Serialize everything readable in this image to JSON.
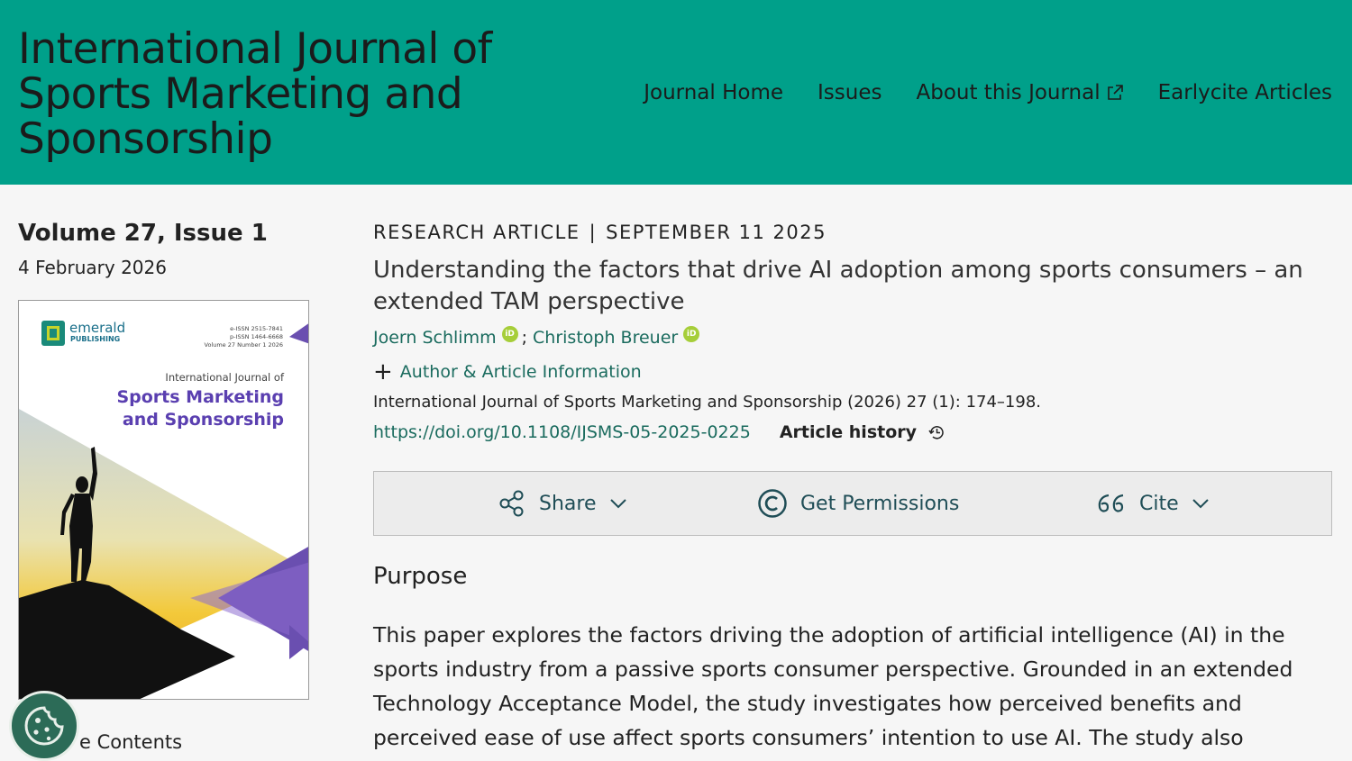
{
  "header": {
    "journal_title": "International Journal of Sports Marketing and Sponsorship",
    "nav": [
      {
        "label": "Journal Home"
      },
      {
        "label": "Issues"
      },
      {
        "label": "About this Journal",
        "icon": "external-link-icon"
      },
      {
        "label": "Earlycite Articles"
      }
    ]
  },
  "sidebar": {
    "volume": "Volume 27, Issue 1",
    "date": "4 February 2026",
    "cover": {
      "publisher_line1": "emerald",
      "publisher_line2": "PUBLISHING",
      "eissn": "e-ISSN 2515-7841",
      "pissn": "p-ISSN 1464-6668",
      "volume_line": "Volume 27 Number 1 2026",
      "journal_line1": "International Journal of",
      "journal_line2": "Sports Marketing",
      "journal_line3": "and Sponsorship"
    },
    "toc_label": "e Contents"
  },
  "article": {
    "type": "RESEARCH ARTICLE",
    "separator": "|",
    "date": "SEPTEMBER 11 2025",
    "title": "Understanding the factors that drive AI adoption among sports consumers – an extended TAM perspective",
    "authors": [
      "Joern Schlimm",
      "Christoph Breuer"
    ],
    "author_separator": ";",
    "orcid_label": "iD",
    "author_info": "Author & Article Information",
    "citation": "International Journal of Sports Marketing and Sponsorship (2026) 27 (1): 174–198.",
    "doi": "https://doi.org/10.1108/IJSMS-05-2025-0225",
    "history_label": "Article history"
  },
  "toolbar": {
    "share": "Share",
    "permissions": "Get Permissions",
    "cite": "Cite"
  },
  "abstract": {
    "heading": "Purpose",
    "text": "This paper explores the factors driving the adoption of artificial intelligence (AI) in the sports industry from a passive sports consumer perspective. Grounded in an extended Technology Acceptance Model, the study investigates how perceived benefits and perceived ease of use affect sports consumers’ intention to use AI. The study also examines social influence,"
  },
  "colors": {
    "header_bg": "#00a08a",
    "link": "#1a6b5e",
    "cover_purple": "#6a4fb0",
    "cookie_bg": "#2c6b57",
    "orcid": "#a6ce39"
  }
}
